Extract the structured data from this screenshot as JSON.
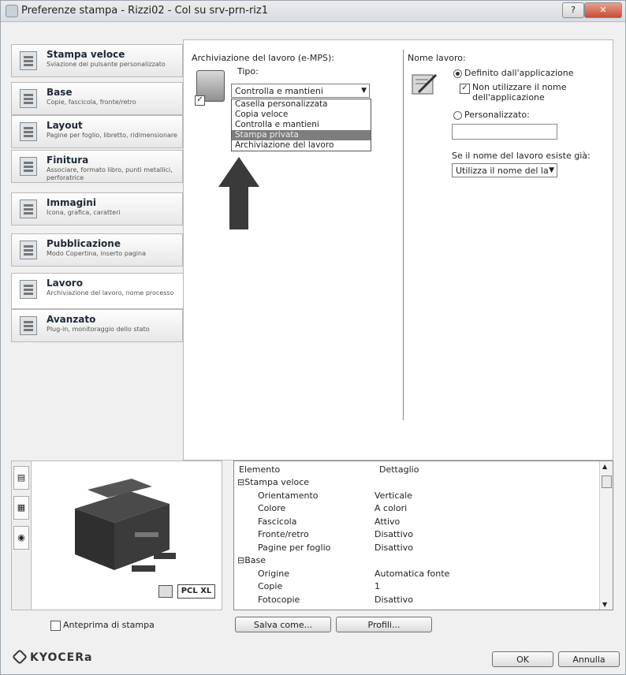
{
  "window": {
    "title": "Preferenze stampa - Rizzi02 - Col su srv-prn-riz1"
  },
  "sidebar": {
    "items": [
      {
        "label": "Stampa veloce",
        "sub": "Sviazione dei pulsante personalizzato",
        "icon": "quick-print-icon"
      },
      {
        "label": "Base",
        "sub": "Copie, fascicola, fronte/retro",
        "icon": "basic-icon"
      },
      {
        "label": "Layout",
        "sub": "Pagine per foglio, libretto, ridimensionare",
        "icon": "layout-icon"
      },
      {
        "label": "Finitura",
        "sub": "Associare, formato libro, punti metallici, perforatrice",
        "icon": "finishing-icon"
      },
      {
        "label": "Immagini",
        "sub": "Icona, grafica, caratteri",
        "icon": "imaging-icon"
      },
      {
        "label": "Pubblicazione",
        "sub": "Modo Copertina, inserto pagina",
        "icon": "publishing-icon"
      },
      {
        "label": "Lavoro",
        "sub": "Archiviazione del lavoro, nome processo",
        "icon": "job-icon"
      },
      {
        "label": "Avanzato",
        "sub": "Plug-in, monitoraggio dello stato",
        "icon": "advanced-icon"
      }
    ],
    "active_index": 6
  },
  "job_storage": {
    "label": "Archiviazione del lavoro (e-MPS):",
    "enabled_mark": "✓",
    "type_label": "Tipo:",
    "type_value": "Controlla e mantieni",
    "options": [
      "Casella personalizzata",
      "Copia veloce",
      "Controlla e mantieni",
      "Stampa privata",
      "Archiviazione del lavoro"
    ],
    "highlighted_index": 3
  },
  "job_name": {
    "label": "Nome lavoro:",
    "option_app": "Definito dall'applicazione",
    "option_no_app_name": "Non utilizzare il nome dell'applicazione",
    "no_app_name_mark": "✓",
    "option_custom": "Personalizzato:",
    "custom_value": "",
    "exists_label": "Se il nome del lavoro esiste già:",
    "exists_value": "Utilizza il nome del la"
  },
  "preview": {
    "badge": "PCL XL"
  },
  "details": {
    "col_element": "Elemento",
    "col_detail": "Dettaglio",
    "rows": [
      {
        "element": "⊟Stampa veloce",
        "detail": "",
        "group": true
      },
      {
        "element": "Orientamento",
        "detail": "Verticale",
        "group": false
      },
      {
        "element": "Colore",
        "detail": "A colori",
        "group": false
      },
      {
        "element": "Fascicola",
        "detail": "Attivo",
        "group": false
      },
      {
        "element": "Fronte/retro",
        "detail": "Disattivo",
        "group": false
      },
      {
        "element": "Pagine per foglio",
        "detail": "Disattivo",
        "group": false
      },
      {
        "element": "⊟Base",
        "detail": "",
        "group": true
      },
      {
        "element": "Origine",
        "detail": "Automatica fonte",
        "group": false
      },
      {
        "element": "Copie",
        "detail": "1",
        "group": false
      },
      {
        "element": "Fotocopie",
        "detail": "Disattivo",
        "group": false
      }
    ]
  },
  "footer": {
    "print_preview": "Anteprima di stampa",
    "save_as": "Salva come...",
    "profiles": "Profili...",
    "ok": "OK",
    "cancel": "Annulla",
    "brand": "KYOCERa"
  }
}
